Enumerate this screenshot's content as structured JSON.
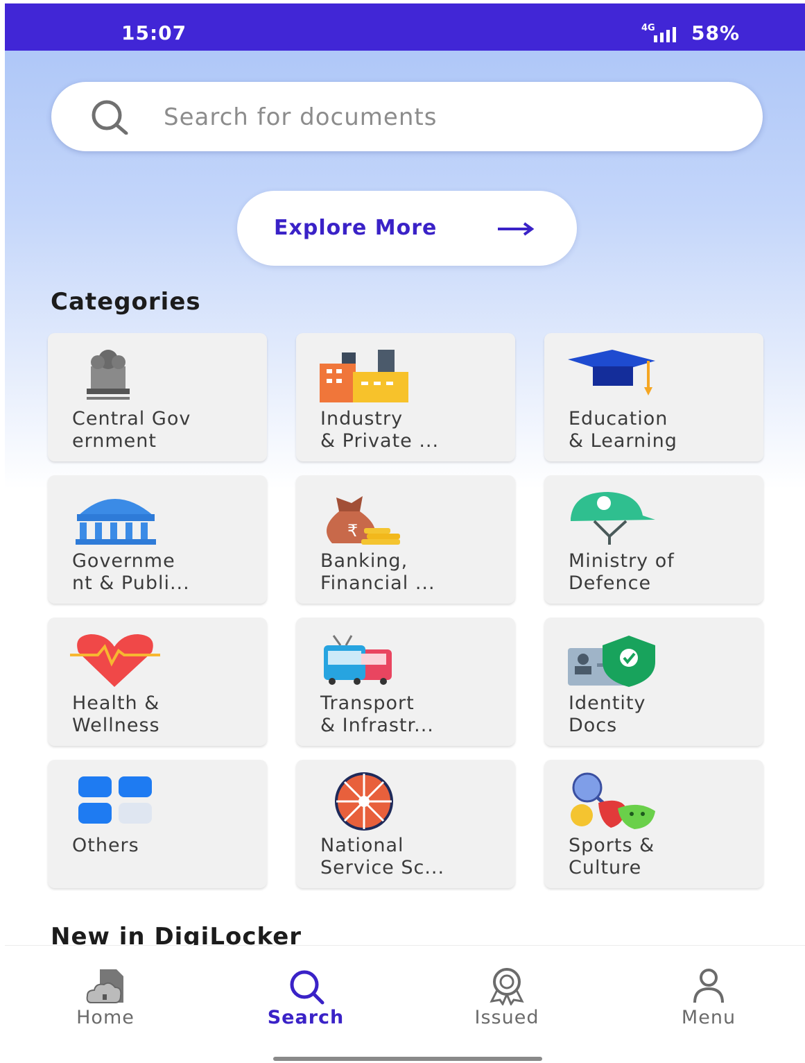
{
  "status_bar": {
    "time": "15:07",
    "network": "4G",
    "battery": "58%"
  },
  "search": {
    "placeholder": "Search for documents",
    "icon": "search-icon"
  },
  "explore": {
    "label": "Explore More",
    "icon": "arrow-right-icon"
  },
  "sections": {
    "categories_title": "Categories",
    "new_title": "New in DigiLocker"
  },
  "categories": [
    {
      "label": "Central Gov\nernment",
      "icon": "national-emblem-icon"
    },
    {
      "label": "Industry\n& Private ...",
      "icon": "factory-icon"
    },
    {
      "label": "Education\n& Learning",
      "icon": "graduation-cap-icon"
    },
    {
      "label": "Governme\nnt & Publi...",
      "icon": "government-building-icon"
    },
    {
      "label": "Banking,\nFinancial ...",
      "icon": "money-bag-icon"
    },
    {
      "label": "Ministry of\nDefence",
      "icon": "soldier-helmet-icon"
    },
    {
      "label": "Health &\nWellness",
      "icon": "heartbeat-icon"
    },
    {
      "label": "Transport\n& Infrastr...",
      "icon": "bus-icon"
    },
    {
      "label": "Identity\nDocs",
      "icon": "id-card-shield-icon"
    },
    {
      "label": "Others",
      "icon": "grid-tiles-icon"
    },
    {
      "label": "National\nService Sc...",
      "icon": "wheel-icon"
    },
    {
      "label": "Sports &\nCulture",
      "icon": "sports-masks-icon"
    }
  ],
  "bottom_nav": [
    {
      "label": "Home",
      "icon": "cloud-home-icon",
      "active": false
    },
    {
      "label": "Search",
      "icon": "search-icon",
      "active": true
    },
    {
      "label": "Issued",
      "icon": "award-badge-icon",
      "active": false
    },
    {
      "label": "Menu",
      "icon": "user-icon",
      "active": false
    }
  ],
  "colors": {
    "primary": "#4126d6",
    "accent_text": "#3a22c7",
    "card_bg": "#f1f1f1"
  }
}
